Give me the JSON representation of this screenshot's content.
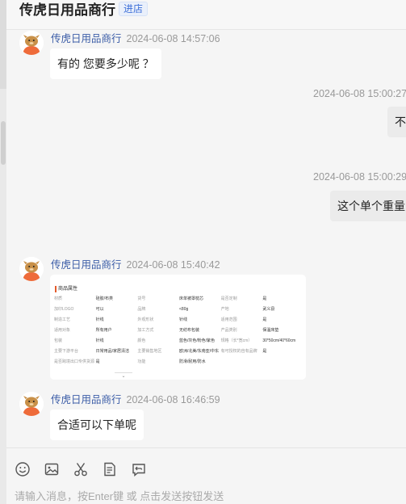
{
  "header": {
    "shop_name": "传虎日用品商行",
    "enter_store_label": "进店"
  },
  "messages": [
    {
      "side": "left",
      "sender": "传虎日用品商行",
      "time": "2024-06-08 14:57:06",
      "text": "有的 您要多少呢 ？"
    },
    {
      "side": "right",
      "time": "2024-06-08 15:00:27",
      "text": "不"
    },
    {
      "side": "right",
      "time": "2024-06-08 15:00:29",
      "text": "这个单个重量"
    },
    {
      "side": "left",
      "sender": "传虎日用品商行",
      "time": "2024-06-08 15:40:42",
      "type": "product_attributes_card"
    },
    {
      "side": "left",
      "sender": "传虎日用品商行",
      "time": "2024-06-08 16:46:59",
      "text": "合适可以下单呢"
    }
  ],
  "product_card": {
    "title": "商品属性",
    "rows": [
      [
        "材质",
        "硅胶/布类",
        "货号",
        "床单被罩枕芯",
        "是否定制",
        "是"
      ],
      [
        "加印LOGO",
        "可以",
        "品牌",
        "<80g",
        "产地",
        "武义县"
      ],
      [
        "制造工艺",
        "针线",
        "外观形状",
        "针线",
        "适用范围",
        "是"
      ],
      [
        "适用对象",
        "所有用户",
        "加工方式",
        "无纺布包装",
        "产品类别",
        "保温床垫"
      ],
      [
        "包装",
        "针线",
        "颜色",
        "蓝色/灰色/粉色/紫色",
        "规格（长*宽cm）",
        "30*50cm/40*60cm"
      ],
      [
        "主要下游平台",
        "日常用品/家居清洁",
        "主要销售地区",
        "欧洲/北美/东南亚/中东",
        "有可授权的自有品牌",
        "是"
      ],
      [
        "是否跨境出口专供货源",
        "是",
        "功能",
        "防滑/耐用/防水",
        "",
        ""
      ]
    ],
    "more_label": "⌄"
  },
  "toolbar": {
    "icons": [
      "emoji-icon",
      "image-icon",
      "scissors-icon",
      "order-icon",
      "history-icon"
    ]
  },
  "composer": {
    "placeholder": "请输入消息，按Enter键 或 点击发送按钮发送"
  }
}
